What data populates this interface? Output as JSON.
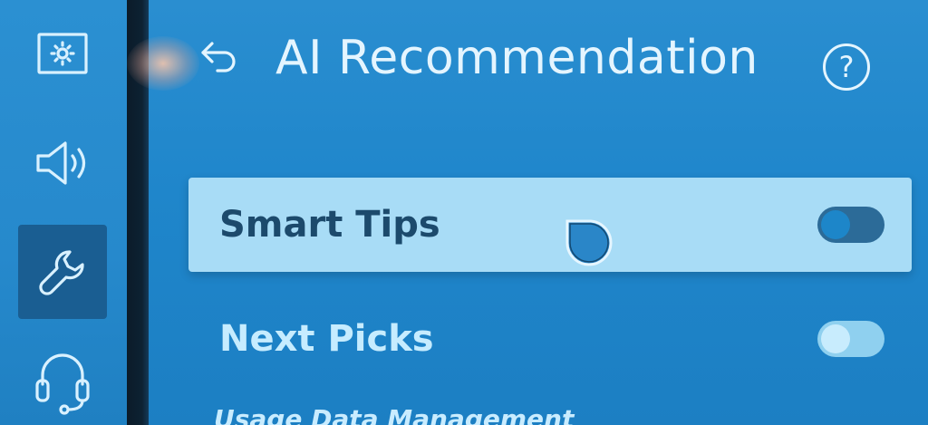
{
  "header": {
    "title": "AI Recommendation",
    "help_label": "?"
  },
  "sidebar": {
    "items": [
      {
        "icon": "picture-icon",
        "active": false
      },
      {
        "icon": "sound-icon",
        "active": false
      },
      {
        "icon": "wrench-icon",
        "active": true
      },
      {
        "icon": "headset-icon",
        "active": false
      }
    ]
  },
  "settings": [
    {
      "label": "Smart Tips",
      "enabled": false,
      "focused": true
    },
    {
      "label": "Next Picks",
      "enabled": false,
      "focused": false
    }
  ],
  "section_caption": "Usage Data Management",
  "colors": {
    "background": "#1f86cb",
    "focus_row": "#a8dcf6",
    "active_rail": "#1a5e92",
    "text": "#e4f5ff"
  }
}
